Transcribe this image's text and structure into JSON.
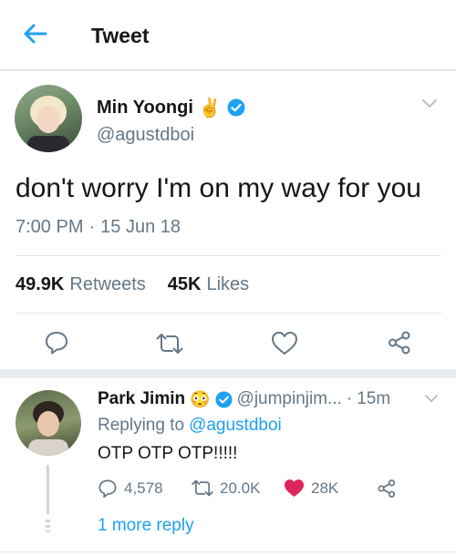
{
  "header": {
    "title": "Tweet"
  },
  "tweet": {
    "author_name": "Min Yoongi",
    "author_emoji": "✌",
    "handle": "@agustdboi",
    "text": "don't worry I'm on my way for you",
    "time": "7:00 PM",
    "separator": "·",
    "date": "15 Jun 18",
    "retweets_count": "49.9K",
    "retweets_label": "Retweets",
    "likes_count": "45K",
    "likes_label": "Likes"
  },
  "reply": {
    "author_name": "Park Jimin",
    "author_emoji": "😳",
    "handle": "@jumpinjim...",
    "separator": "·",
    "age": "15m",
    "replying_prefix": "Replying to",
    "replying_handle": "@agustdboi",
    "text": "OTP OTP OTP!!!!!",
    "reply_count": "4,578",
    "retweet_count": "20.0K",
    "like_count": "28K",
    "more_replies": "1 more reply"
  },
  "colors": {
    "accent": "#1da1f2",
    "like": "#e0245e",
    "muted": "#657786",
    "verified": "#1da1f2"
  }
}
